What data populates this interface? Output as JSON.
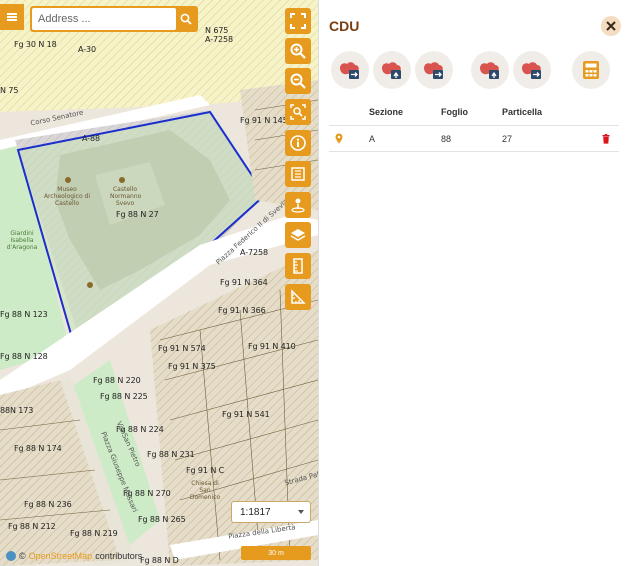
{
  "map": {
    "search": {
      "placeholder": "Address ...",
      "value": ""
    },
    "labels": {
      "fg30n18": "Fg 30 N 18",
      "a30": "A-30",
      "fg88n27": "Fg 88 N 27",
      "fg88n123": "Fg 88 N 123",
      "fg88n128": "Fg 88 N 128",
      "fg88n220": "Fg 88 N 220",
      "fg88n225": "Fg 88 N 225",
      "fg88n224": "Fg 88 N 224",
      "fg88n173": "88N 173",
      "fg88n174": "Fg 88 N 174",
      "fg88n231": "Fg 88 N 231",
      "fg88n270": "Fg 88 N 270",
      "fg88n236": "Fg 88 N 236",
      "fg88n212": "Fg 88 N 212",
      "fg88n219": "Fg 88 N 219",
      "fg88n265": "Fg 88 N 265",
      "fg88nd": "Fg 88 N D",
      "fg91n574": "Fg 91 N 574",
      "fg91n364": "Fg 91 N 364",
      "fg91n366": "Fg 91 N 366",
      "fg91n410": "Fg 91 N 410",
      "fg91n541": "Fg 91 N 541",
      "fg91n375": "Fg 91 N 375",
      "fg91nc": "Fg 91 N C",
      "a7258": "A-7258",
      "a7258b": "A-7258",
      "n675": "N 675",
      "a88": "A-88",
      "a75": "N 75",
      "fgn145": "Fg 91 N 145"
    },
    "streets": {
      "corso": "Corso Senatore",
      "piazza_ff": "Piazza Federico II di Svevia",
      "piazza_gm": "Piazza Giuseppe Massari",
      "via_sp": "Via San Pietro",
      "piazza_lib": "Piazza della Libertà",
      "strada": "Strada Pal..."
    },
    "pois": {
      "museo": "Museo Archeologico di Castello",
      "castello": "Castello Normanno Svevo",
      "giardini": "Giardini Isabella d'Aragona",
      "chiesa": "Chiesa di San Domenico"
    },
    "scale": "1:1817",
    "scale_bar": "30 m",
    "attribution": {
      "prefix": "©",
      "osm": "OpenStreetMap",
      "suffix": "contributors"
    }
  },
  "panel": {
    "title": "CDU",
    "table": {
      "headers": [
        "Sezione",
        "Foglio",
        "Particella"
      ],
      "rows": [
        {
          "sezione": "A",
          "foglio": "88",
          "particella": "27"
        }
      ]
    }
  },
  "colors": {
    "accent": "#e69b1f",
    "title": "#7a3d10",
    "delete": "#d9161c",
    "selection": "#1a2fcc"
  },
  "icons": {
    "toolbar": [
      "fullscreen-icon",
      "zoom-in-icon",
      "zoom-out-icon",
      "zoom-extent-icon",
      "info-icon",
      "legend-icon",
      "locate-icon",
      "layers-icon",
      "measure-length-icon",
      "measure-area-icon"
    ],
    "panel_actions": [
      "add-parcel-icon",
      "select-parcel-icon",
      "remove-parcel-icon",
      "select-area-icon",
      "export-icon",
      "calculator-icon"
    ]
  }
}
